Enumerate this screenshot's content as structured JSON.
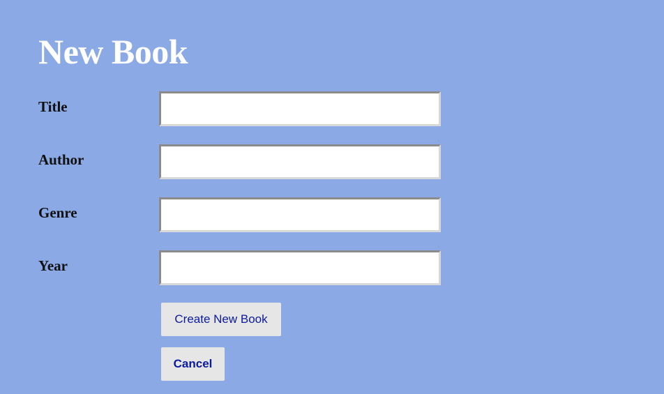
{
  "page": {
    "title": "New Book"
  },
  "form": {
    "fields": [
      {
        "label": "Title",
        "value": ""
      },
      {
        "label": "Author",
        "value": ""
      },
      {
        "label": "Genre",
        "value": ""
      },
      {
        "label": "Year",
        "value": ""
      }
    ],
    "submit_label": "Create New Book",
    "cancel_label": "Cancel"
  },
  "colors": {
    "background": "#8aa9e5",
    "title": "#ffffff",
    "label": "#111111",
    "button_background": "#e6e6e6",
    "button_text": "#0b1aa0"
  }
}
